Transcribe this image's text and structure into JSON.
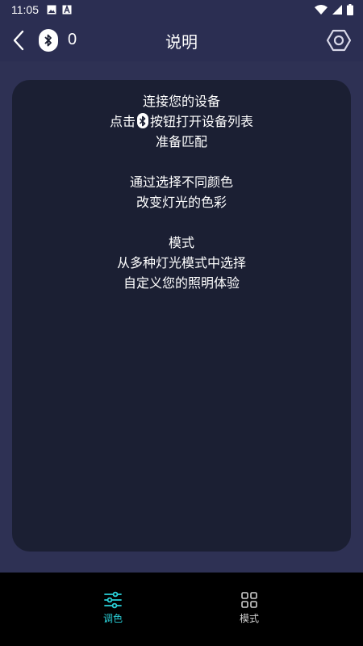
{
  "status": {
    "time": "11:05"
  },
  "header": {
    "title": "说明",
    "bt_count": "0"
  },
  "card": {
    "p1_l1": "连接您的设备",
    "p1_l2_pre": "点击",
    "p1_l2_post": "按钮打开设备列表",
    "p1_l3": "准备匹配",
    "p2_l1": "通过选择不同颜色",
    "p2_l2": "改变灯光的色彩",
    "p3_l1": "模式",
    "p3_l2": "从多种灯光模式中选择",
    "p3_l3": "自定义您的照明体验"
  },
  "nav": {
    "items": [
      {
        "label": "调色",
        "active": true
      },
      {
        "label": "模式",
        "active": false
      }
    ]
  },
  "colors": {
    "accent": "#2ad0d8",
    "card_bg": "#1b1f33",
    "page_bg": "#2e3154"
  }
}
